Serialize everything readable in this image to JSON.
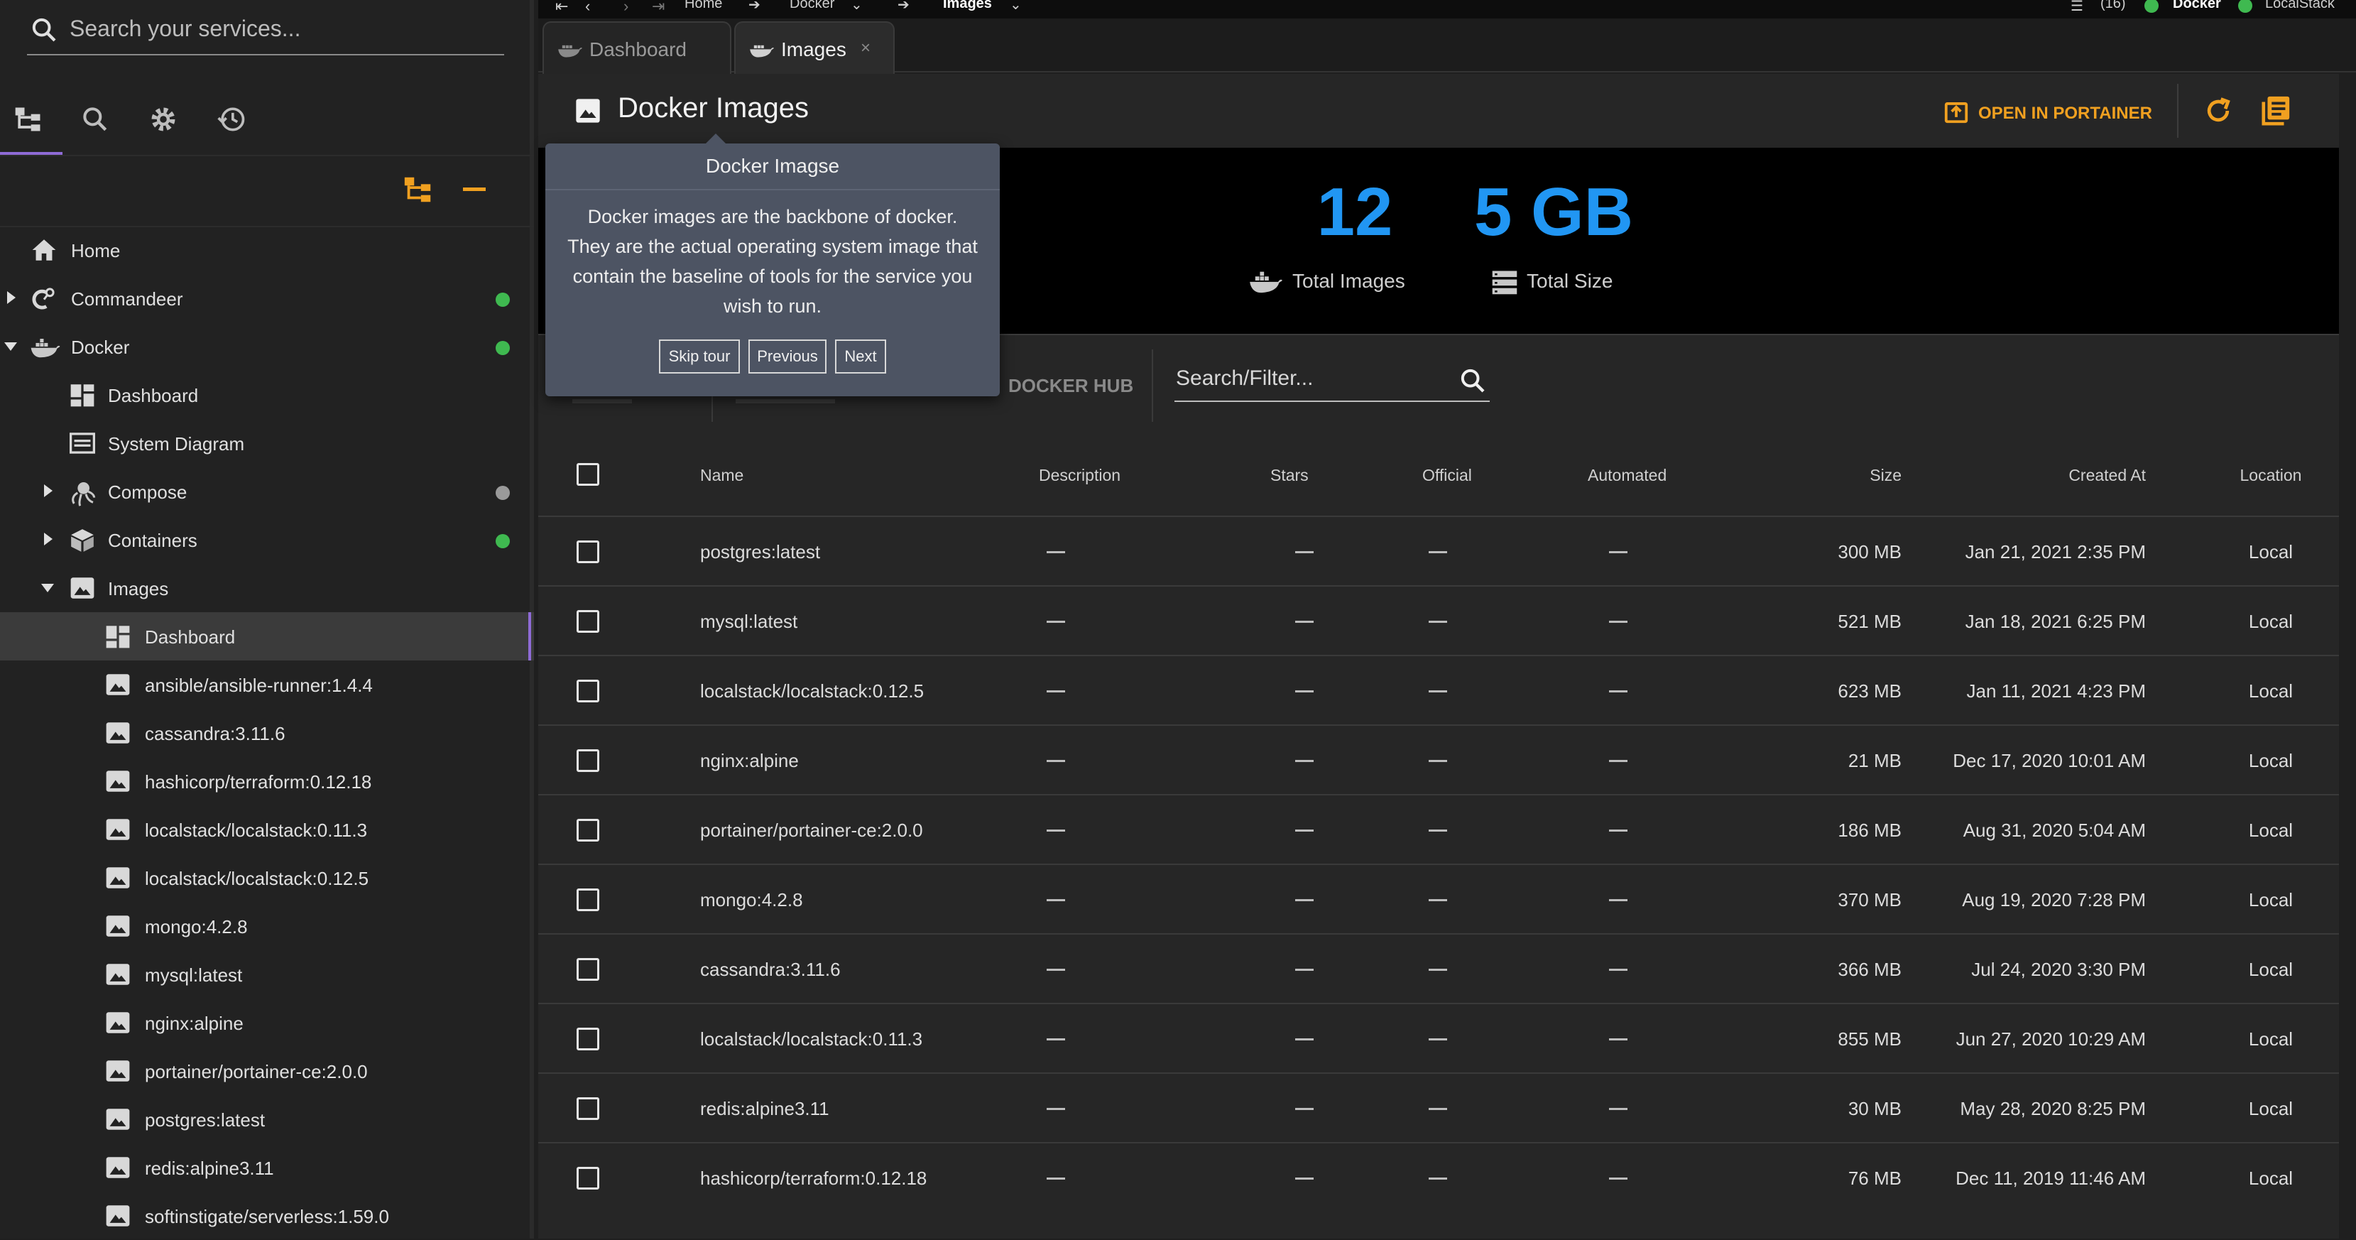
{
  "sidebar": {
    "search_placeholder": "Search your services...",
    "items": [
      {
        "label": "Home"
      },
      {
        "label": "Commandeer"
      },
      {
        "label": "Docker"
      },
      {
        "label": "Dashboard"
      },
      {
        "label": "System Diagram"
      },
      {
        "label": "Compose"
      },
      {
        "label": "Containers"
      },
      {
        "label": "Images"
      },
      {
        "label": "Dashboard"
      }
    ],
    "images": [
      "ansible/ansible-runner:1.4.4",
      "cassandra:3.11.6",
      "hashicorp/terraform:0.12.18",
      "localstack/localstack:0.11.3",
      "localstack/localstack:0.12.5",
      "mongo:4.2.8",
      "mysql:latest",
      "nginx:alpine",
      "portainer/portainer-ce:2.0.0",
      "postgres:latest",
      "redis:alpine3.11",
      "softinstigate/serverless:1.59.0"
    ],
    "status_colors": {
      "green": "#3fb950",
      "gray": "#9a9a9a"
    }
  },
  "topbar": {
    "crumbs": [
      "Home",
      "Docker",
      "Images"
    ],
    "count": "(16)",
    "env1": "Docker",
    "env2": "LocalStack"
  },
  "tabs": [
    {
      "label": "Dashboard"
    },
    {
      "label": "Images",
      "close": "×"
    }
  ],
  "header": {
    "title": "Docker Images",
    "open_portainer": "OPEN IN PORTAINER",
    "accent": "#f0a020"
  },
  "stats": {
    "total_images_value": "12",
    "total_images_label": "Total Images",
    "total_size_value": "5 GB",
    "total_size_label": "Total Size",
    "value_color": "#2196f3"
  },
  "filter": {
    "docker_hub": "DOCKER HUB",
    "search_placeholder": "Search/Filter..."
  },
  "table": {
    "columns": [
      "Name",
      "Description",
      "Stars",
      "Official",
      "Automated",
      "Size",
      "Created At",
      "Location"
    ],
    "rows": [
      {
        "name": "postgres:latest",
        "size": "300 MB",
        "created": "Jan 21, 2021 2:35 PM",
        "location": "Local"
      },
      {
        "name": "mysql:latest",
        "size": "521 MB",
        "created": "Jan 18, 2021 6:25 PM",
        "location": "Local"
      },
      {
        "name": "localstack/localstack:0.12.5",
        "size": "623 MB",
        "created": "Jan 11, 2021 4:23 PM",
        "location": "Local"
      },
      {
        "name": "nginx:alpine",
        "size": "21 MB",
        "created": "Dec 17, 2020 10:01 AM",
        "location": "Local"
      },
      {
        "name": "portainer/portainer-ce:2.0.0",
        "size": "186 MB",
        "created": "Aug 31, 2020 5:04 AM",
        "location": "Local"
      },
      {
        "name": "mongo:4.2.8",
        "size": "370 MB",
        "created": "Aug 19, 2020 7:28 PM",
        "location": "Local"
      },
      {
        "name": "cassandra:3.11.6",
        "size": "366 MB",
        "created": "Jul 24, 2020 3:30 PM",
        "location": "Local"
      },
      {
        "name": "localstack/localstack:0.11.3",
        "size": "855 MB",
        "created": "Jun 27, 2020 10:29 AM",
        "location": "Local"
      },
      {
        "name": "redis:alpine3.11",
        "size": "30 MB",
        "created": "May 28, 2020 8:25 PM",
        "location": "Local"
      },
      {
        "name": "hashicorp/terraform:0.12.18",
        "size": "76 MB",
        "created": "Dec 11, 2019 11:46 AM",
        "location": "Local"
      }
    ]
  },
  "tour": {
    "title": "Docker Imagse",
    "body": "Docker images are the backbone of docker. They are the actual operating system image that contain the baseline of tools for the service you wish to run.",
    "skip": "Skip tour",
    "previous": "Previous",
    "next": "Next"
  }
}
